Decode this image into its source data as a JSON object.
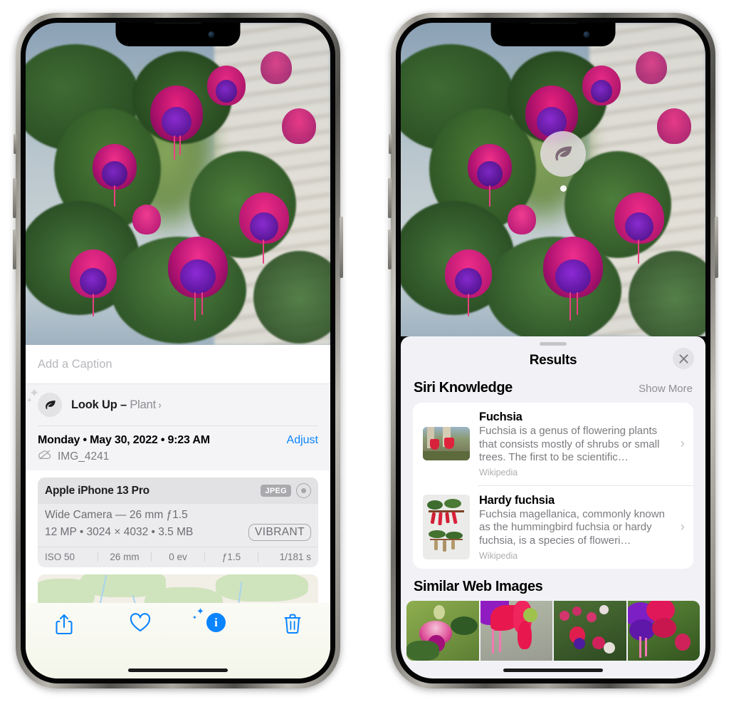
{
  "left_phone": {
    "name": "photo-detail-screen",
    "caption": {
      "placeholder": "Add a Caption",
      "value": ""
    },
    "lookup": {
      "icon": "leaf-icon",
      "sparkle": "sparkles-icon",
      "label": "Look Up – ",
      "subject": "Plant",
      "chevron": "›"
    },
    "metadata": {
      "date": "Monday • May 30, 2022 • 9:23 AM",
      "adjust_label": "Adjust",
      "cloud_icon": "cloud-slash-icon",
      "filename": "IMG_4241"
    },
    "camera_card": {
      "device": "Apple iPhone 13 Pro",
      "format_badge": "JPEG",
      "aperture_icon": "aperture-icon",
      "lens_line": "Wide Camera — 26 mm ƒ1.5",
      "details_line": "12 MP • 3024 × 4032 • 3.5 MB",
      "style_badge": "VIBRANT",
      "exif": [
        "ISO 50",
        "26 mm",
        "0 ev",
        "ƒ1.5",
        "1/181 s"
      ]
    },
    "map": {
      "name": "location-map",
      "pin": "photo-pin"
    },
    "toolbar": {
      "share": "share-icon",
      "favorite": "heart-icon",
      "info": "info-sparkle-icon",
      "info_glyph": "i",
      "delete": "trash-icon"
    }
  },
  "right_phone": {
    "name": "visual-lookup-results-screen",
    "photo_badge": {
      "icon": "leaf-icon",
      "name": "visual-lookup-badge"
    },
    "sheet": {
      "grabber": "drag-handle",
      "title": "Results",
      "close_icon": "close-icon"
    },
    "siri_knowledge": {
      "title": "Siri Knowledge",
      "show_more": "Show More",
      "items": [
        {
          "title": "Fuchsia",
          "desc": "Fuchsia is a genus of flowering plants that consists mostly of shrubs or small trees. The first to be scientific…",
          "source": "Wikipedia",
          "thumb": "fuchsia-thumbnail",
          "chevron": "›"
        },
        {
          "title": "Hardy fuchsia",
          "desc": "Fuchsia magellanica, commonly known as the hummingbird fuchsia or hardy fuchsia, is a species of floweri…",
          "source": "Wikipedia",
          "thumb": "hardy-fuchsia-thumbnail",
          "chevron": "›"
        }
      ]
    },
    "similar_web_images": {
      "title": "Similar Web Images",
      "images": [
        "web-image-1",
        "web-image-2",
        "web-image-3",
        "web-image-4"
      ]
    }
  },
  "colors": {
    "accent_blue": "#0a84ff",
    "sheet_gray": "#f2f2f6",
    "card_white": "#ffffff",
    "secondary_text": "#8e8e93",
    "badge_gray": "#aaaaae"
  }
}
